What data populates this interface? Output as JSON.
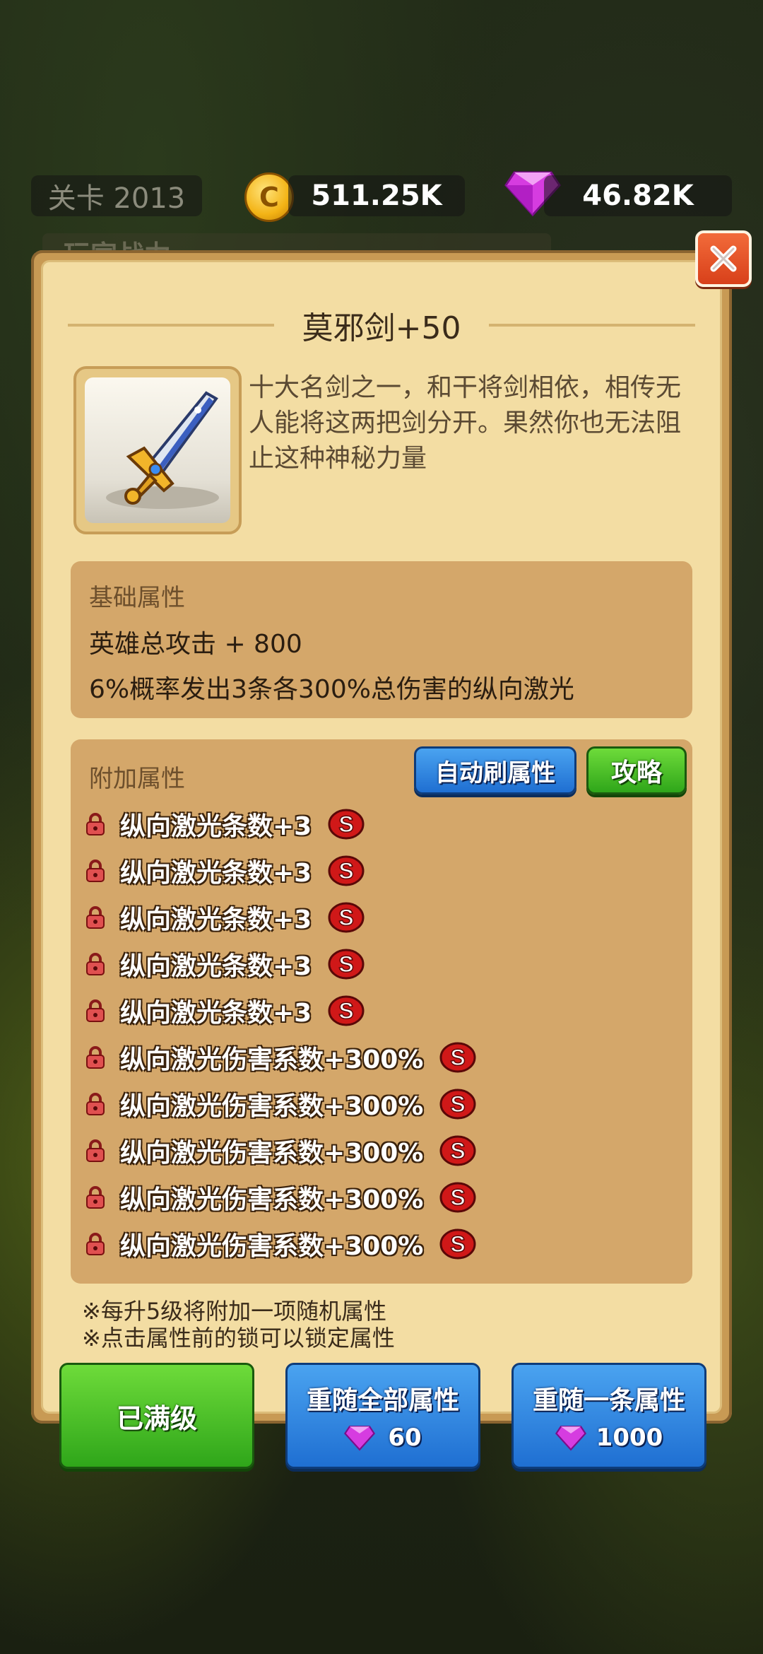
{
  "hud": {
    "level": "关卡 2013",
    "coins": "511.25K",
    "gems": "46.82K",
    "dim_label": "玩家战力"
  },
  "item": {
    "title": "莫邪剑+50",
    "description": "十大名剑之一，和干将剑相依，相传无人能将这两把剑分开。果然你也无法阻止这种神秘力量"
  },
  "basic": {
    "label": "基础属性",
    "lines": [
      "英雄总攻击 + 800",
      "6%概率发出3条各300%总伤害的纵向激光"
    ]
  },
  "extra": {
    "label": "附加属性",
    "auto_button": "自动刷属性",
    "guide_button": "攻略",
    "grade": "S",
    "attributes": [
      "纵向激光条数+3",
      "纵向激光条数+3",
      "纵向激光条数+3",
      "纵向激光条数+3",
      "纵向激光条数+3",
      "纵向激光伤害系数+300%",
      "纵向激光伤害系数+300%",
      "纵向激光伤害系数+300%",
      "纵向激光伤害系数+300%",
      "纵向激光伤害系数+300%"
    ]
  },
  "notes": [
    "※每升5级将附加一项随机属性",
    "※点击属性前的锁可以锁定属性"
  ],
  "actions": {
    "max_level": "已满级",
    "reroll_all": "重随全部属性",
    "reroll_all_cost": "60",
    "reroll_one": "重随一条属性",
    "reroll_one_cost": "1000"
  },
  "colors": {
    "panel": "#f3dda3",
    "box": "#d4a76a",
    "blue_button": "#1f6fd2",
    "green_button": "#2fa61a",
    "s_badge": "#d01818"
  }
}
